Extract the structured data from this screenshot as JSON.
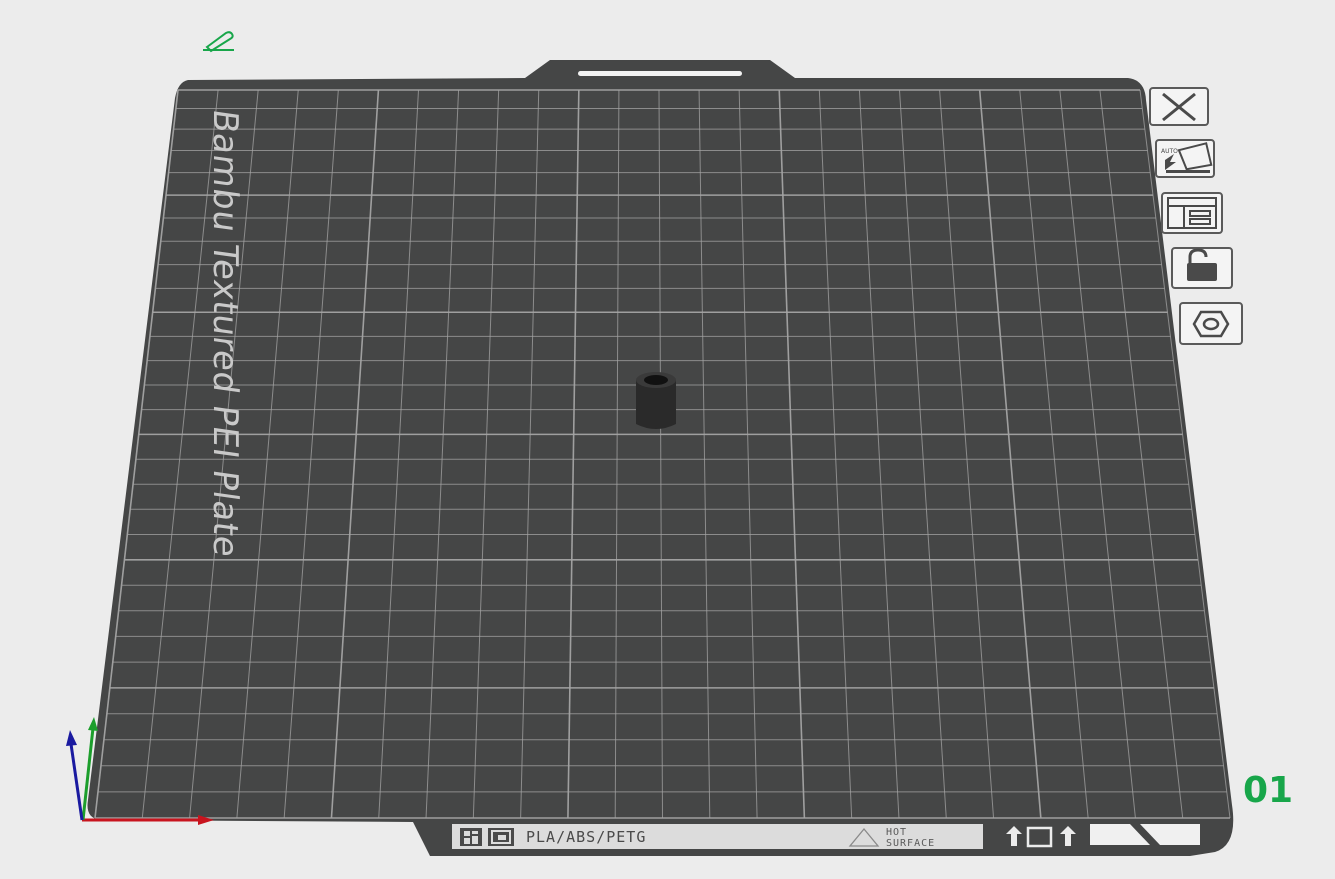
{
  "plate": {
    "name": "Bambu Textured PEI Plate",
    "number": "01",
    "material_strip": "PLA/ABS/PETG",
    "hot_surface_line1": "HOT",
    "hot_surface_line2": "SURFACE"
  },
  "toolbar": {
    "items": [
      {
        "name": "close-plate-button",
        "icon": "close-icon"
      },
      {
        "name": "auto-orient-button",
        "icon": "auto-orient-icon",
        "label": "AUTO"
      },
      {
        "name": "arrange-button",
        "icon": "arrange-icon"
      },
      {
        "name": "lock-plate-button",
        "icon": "unlock-icon"
      },
      {
        "name": "plate-settings-button",
        "icon": "hex-nut-icon"
      }
    ]
  },
  "edit_icon": "pencil-icon",
  "colors": {
    "background": "#ececec",
    "plate": "#454646",
    "grid": "#9a9a9a",
    "accent_green": "#18a64a",
    "axis_x": "#c8141e",
    "axis_y": "#1c9e2c",
    "axis_z": "#1a1aa0"
  }
}
